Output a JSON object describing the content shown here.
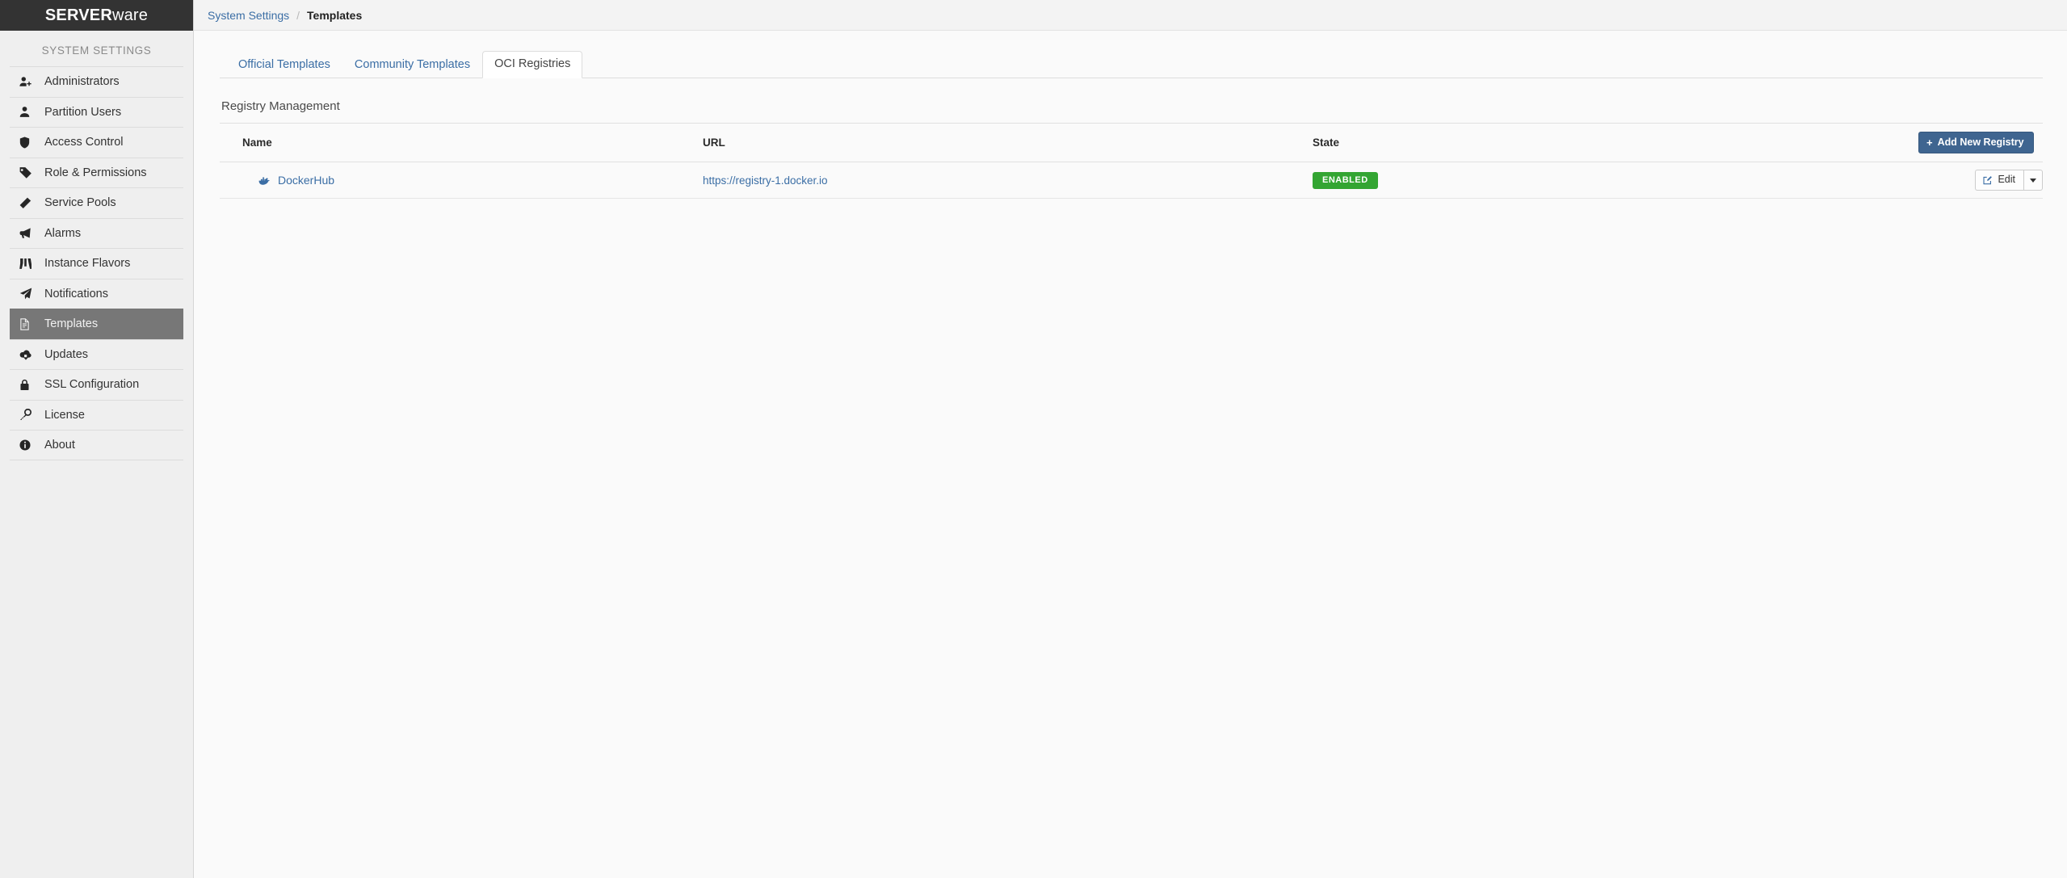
{
  "brand": {
    "name_strong": "SERVER",
    "name_light": "ware"
  },
  "sidebar": {
    "section_title": "SYSTEM SETTINGS",
    "items": [
      {
        "label": "Administrators",
        "icon": "user-plus-icon",
        "active": false
      },
      {
        "label": "Partition Users",
        "icon": "user-icon",
        "active": false
      },
      {
        "label": "Access Control",
        "icon": "shield-icon",
        "active": false
      },
      {
        "label": "Role & Permissions",
        "icon": "tag-icon",
        "active": false
      },
      {
        "label": "Service Pools",
        "icon": "layers-icon",
        "active": false
      },
      {
        "label": "Alarms",
        "icon": "bullhorn-icon",
        "active": false
      },
      {
        "label": "Instance Flavors",
        "icon": "binoculars-icon",
        "active": false
      },
      {
        "label": "Notifications",
        "icon": "paper-plane-icon",
        "active": false
      },
      {
        "label": "Templates",
        "icon": "file-text-icon",
        "active": true
      },
      {
        "label": "Updates",
        "icon": "cloud-download-icon",
        "active": false
      },
      {
        "label": "SSL Configuration",
        "icon": "lock-icon",
        "active": false
      },
      {
        "label": "License",
        "icon": "key-icon",
        "active": false
      },
      {
        "label": "About",
        "icon": "info-circle-icon",
        "active": false
      }
    ]
  },
  "breadcrumb": {
    "parent": "System Settings",
    "separator": "/",
    "current": "Templates"
  },
  "tabs": [
    {
      "label": "Official Templates",
      "active": false
    },
    {
      "label": "Community Templates",
      "active": false
    },
    {
      "label": "OCI Registries",
      "active": true
    }
  ],
  "panel": {
    "title": "Registry Management",
    "add_button": {
      "label": "Add New Registry",
      "plus": "+",
      "icon": "plus-icon"
    },
    "table": {
      "columns": [
        "Name",
        "URL",
        "State"
      ],
      "rows": [
        {
          "icon": "docker-icon",
          "name": "DockerHub",
          "url": "https://registry-1.docker.io",
          "state": "ENABLED",
          "edit_label": "Edit"
        }
      ]
    }
  },
  "colors": {
    "brand_bar": "#333333",
    "sidebar_bg": "#efefef",
    "active_item_bg": "#777777",
    "link_blue": "#3b6ea5",
    "primary_button": "#3f6590",
    "enabled_green": "#33a532"
  }
}
